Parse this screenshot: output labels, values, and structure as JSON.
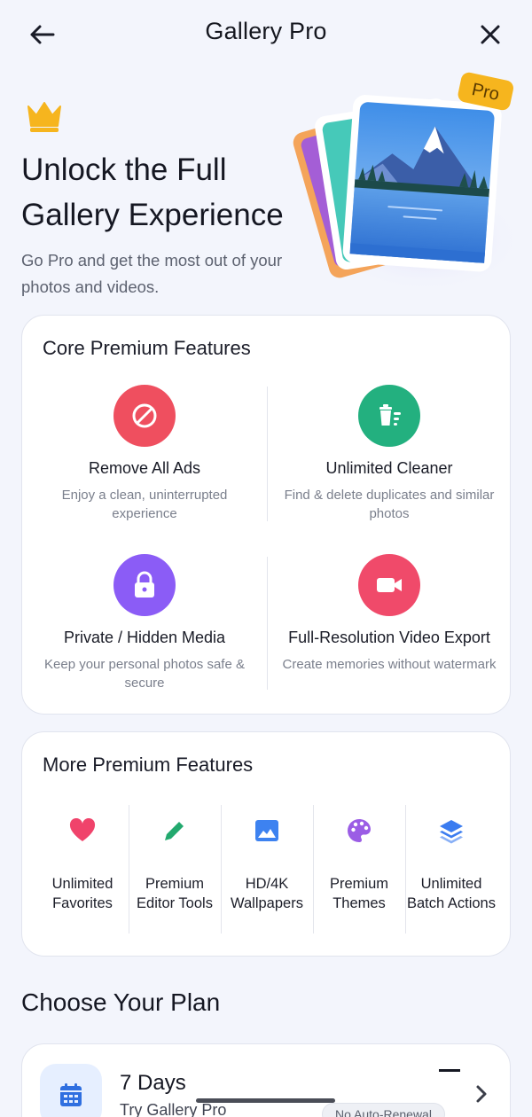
{
  "header": {
    "title": "Gallery Pro",
    "back_icon": "arrow-left-icon",
    "close_icon": "close-icon"
  },
  "hero": {
    "crown_icon": "crown-icon",
    "title": "Unlock the Full Gallery Experience",
    "subtitle": "Go Pro and get the most out of your photos and videos.",
    "badge": "Pro"
  },
  "core": {
    "title": "Core Premium Features",
    "items": [
      {
        "name": "Remove All Ads",
        "desc": "Enjoy a clean, uninterrupted experience",
        "icon": "block-icon",
        "color": "#ef4f5f"
      },
      {
        "name": "Unlimited Cleaner",
        "desc": "Find & delete duplicates and similar photos",
        "icon": "trash-clean-icon",
        "color": "#23b07f"
      },
      {
        "name": "Private / Hidden Media",
        "desc": "Keep your personal photos safe & secure",
        "icon": "lock-icon",
        "color": "#8b5cf6"
      },
      {
        "name": "Full-Resolution Video Export",
        "desc": "Create memories without watermark",
        "icon": "video-camera-icon",
        "color": "#f04a6a"
      }
    ]
  },
  "more": {
    "title": "More Premium Features",
    "items": [
      {
        "name": "Unlimited Favorites",
        "icon": "heart-icon",
        "color": "#f0436b"
      },
      {
        "name": "Premium Editor Tools",
        "icon": "pencil-icon",
        "color": "#22a96e"
      },
      {
        "name": "HD/4K Wallpapers",
        "icon": "image-icon",
        "color": "#3d82f0"
      },
      {
        "name": "Premium Themes",
        "icon": "palette-icon",
        "color": "#9b5de5"
      },
      {
        "name": "Unlimited Batch Actions",
        "icon": "layers-icon",
        "color": "#3b7cf0"
      }
    ]
  },
  "plans": {
    "heading": "Choose Your Plan",
    "items": [
      {
        "name": "7 Days",
        "subtitle": "Try Gallery Pro",
        "badge": "No Auto-Renewal",
        "icon": "calendar-icon"
      }
    ]
  },
  "colors": {
    "background": "#f3f5fc",
    "card": "#ffffff",
    "accent": "#f6b51e"
  }
}
